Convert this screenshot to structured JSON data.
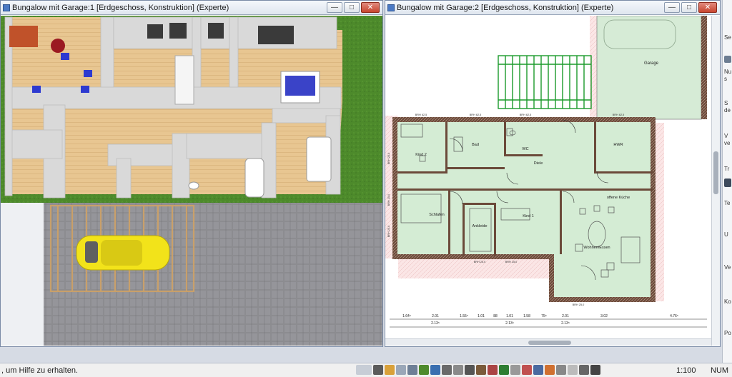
{
  "window_left": {
    "title": "Bungalow mit Garage:1 [Erdgeschoss, Konstruktion] (Experte)",
    "buttons": {
      "minimize": "—",
      "maximize": "□",
      "close": "✕"
    }
  },
  "window_right": {
    "title": "Bungalow mit Garage:2 [Erdgeschoss, Konstruktion] (Experte)",
    "buttons": {
      "minimize": "—",
      "maximize": "□",
      "close": "✕"
    }
  },
  "plan": {
    "rooms": {
      "garage": "Garage",
      "kind2": "Kind 2",
      "bad": "Bad",
      "wc": "WC",
      "hwr": "HWR",
      "diele": "Diele",
      "schlafen": "Schlafen",
      "ankleide": "Ankleide",
      "kind1": "Kind 1",
      "kueche": "offene Küche",
      "wohnen": "Wohnen/Essen"
    },
    "brh_top": [
      "BRH 62,5",
      "BRH 62,5",
      "BRH 62,5",
      "BRH 62,5"
    ],
    "brh_side_left": [
      "BRH 25,0",
      "BRH 25,0",
      "BRH 25,0"
    ],
    "brh_bottom": [
      "BRH 25,0",
      "BRH 25,0",
      "BRH 25,0"
    ],
    "dimensions_row1": [
      "1.64⁵",
      "2.01",
      "1.55⁵",
      "1.01",
      "88",
      "1.01",
      "1.58",
      "75⁵",
      "2.01",
      "3.02",
      "4.76⁵"
    ],
    "dimensions_row2": [
      "2.13⁵",
      "2.13⁵",
      "2.13⁵"
    ]
  },
  "status": {
    "message": ", um Hilfe zu erhalten.",
    "scale": "1:100",
    "mode": "NUM"
  },
  "right_panel": [
    "Se",
    "Nu",
    "s",
    "S",
    "de",
    "V",
    "ve",
    "Tr",
    "Te",
    "U",
    "Ve",
    "Ko",
    "Po"
  ],
  "colors": {
    "grass": "#4f8a2c",
    "floor_wood": "#e6c48f",
    "wall_3d": "#dadada",
    "pavement": "#8a8a8e",
    "car": "#f2e31a",
    "plan_room": "#d4ecd4",
    "plan_wall": "#6b4a3a",
    "plan_hatch": "#f3d6d6",
    "carport_green": "#1a9a2a"
  }
}
